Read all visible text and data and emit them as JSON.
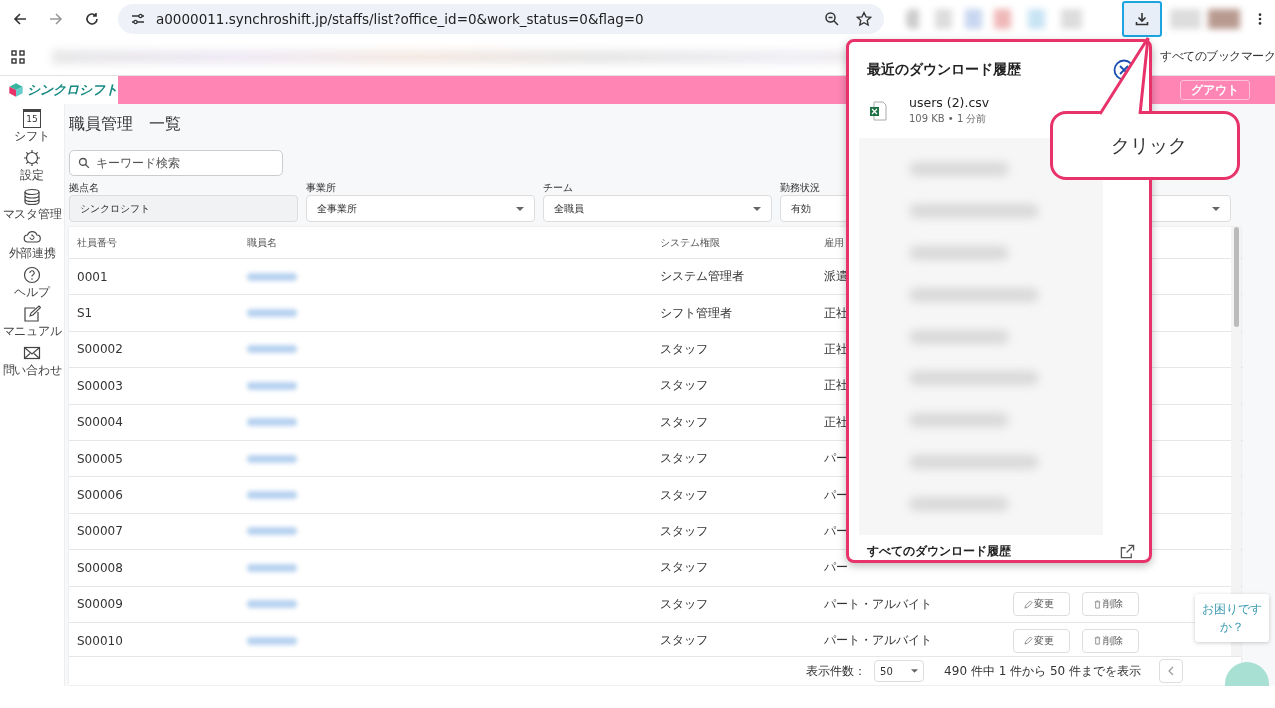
{
  "browser": {
    "url": "a0000011.synchroshift.jp/staffs/list?office_id=0&work_status=0&flag=0",
    "bookmarks_label": "すべてのブックマーク"
  },
  "app": {
    "logo": "シンクロシフト",
    "logout": "グアウト"
  },
  "sidebar": [
    {
      "kind": "calendar",
      "day": "15",
      "label": "シフト"
    },
    {
      "kind": "gear",
      "label": "設定"
    },
    {
      "kind": "database",
      "label": "マスタ管理"
    },
    {
      "kind": "cloud",
      "label": "外部連携"
    },
    {
      "kind": "help",
      "label": "ヘルプ"
    },
    {
      "kind": "pen",
      "label": "マニュアル"
    },
    {
      "kind": "mail",
      "label": "問い合わせ"
    }
  ],
  "page_title": "職員管理　一覧",
  "search": {
    "placeholder": "キーワード検索"
  },
  "filters": [
    {
      "kind": "readonly",
      "label": "拠点名",
      "value": "シンクロシフト"
    },
    {
      "kind": "select",
      "label": "事業所",
      "value": "全事業所"
    },
    {
      "kind": "select",
      "label": "チーム",
      "value": "全職員"
    },
    {
      "kind": "select",
      "label": "勤務状況",
      "value": "有効"
    },
    {
      "kind": "select"
    }
  ],
  "table": {
    "columns": [
      "社員番号",
      "職員名",
      "システム権限",
      "雇用"
    ],
    "rows": [
      {
        "id": "0001",
        "role": "システム管理者",
        "employment": "派遣"
      },
      {
        "id": "S1",
        "role": "シフト管理者",
        "employment": "正社"
      },
      {
        "id": "S00002",
        "role": "スタッフ",
        "employment": "正社"
      },
      {
        "id": "S00003",
        "role": "スタッフ",
        "employment": "正社"
      },
      {
        "id": "S00004",
        "role": "スタッフ",
        "employment": "正社"
      },
      {
        "id": "S00005",
        "role": "スタッフ",
        "employment": "パー"
      },
      {
        "id": "S00006",
        "role": "スタッフ",
        "employment": "パー"
      },
      {
        "id": "S00007",
        "role": "スタッフ",
        "employment": "パー"
      },
      {
        "id": "S00008",
        "role": "スタッフ",
        "employment": "パー"
      },
      {
        "id": "S00009",
        "role": "スタッフ",
        "employment": "パート・アルバイト",
        "actions": [
          "変更",
          "削除"
        ]
      },
      {
        "id": "S00010",
        "role": "スタッフ",
        "employment": "パート・アルバイト",
        "actions": [
          "変更",
          "削除"
        ]
      }
    ]
  },
  "pagination": {
    "per_page_label": "表示件数：",
    "per_page": "50",
    "summary": "490 件中 1 件から 50 件までを表示"
  },
  "downloads": {
    "title": "最近のダウンロード履歴",
    "items": [
      {
        "name": "users (2).csv",
        "meta": "109 KB • 1 分前"
      }
    ],
    "footer": "すべてのダウンロード履歴"
  },
  "callout": {
    "text": "クリック"
  },
  "help_bubble": "お困りですか？"
}
